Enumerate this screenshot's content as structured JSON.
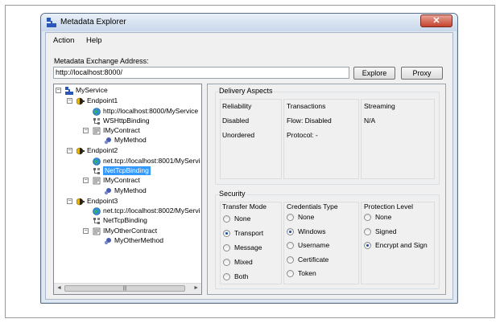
{
  "window": {
    "title": "Metadata Explorer",
    "close_glyph": "✕"
  },
  "menu": {
    "items": [
      "Action",
      "Help"
    ]
  },
  "address": {
    "label": "Metadata Exchange Address:",
    "value": "http://localhost:8000/",
    "explore_label": "Explore",
    "proxy_label": "Proxy"
  },
  "tree": {
    "nodes": [
      {
        "label": "MyService",
        "icon": "service-icon"
      },
      {
        "label": "Endpoint1",
        "icon": "endpoint-icon"
      },
      {
        "label": "http://localhost:8000/MyService",
        "icon": "address-globe-icon"
      },
      {
        "label": "WSHttpBinding",
        "icon": "binding-icon"
      },
      {
        "label": "IMyContract",
        "icon": "contract-icon"
      },
      {
        "label": "MyMethod",
        "icon": "method-icon"
      },
      {
        "label": "Endpoint2",
        "icon": "endpoint-icon"
      },
      {
        "label": "net.tcp://localhost:8001/MyServi",
        "icon": "address-globe-icon"
      },
      {
        "label": "NetTcpBinding",
        "icon": "binding-icon",
        "selected": true
      },
      {
        "label": "IMyContract",
        "icon": "contract-icon"
      },
      {
        "label": "MyMethod",
        "icon": "method-icon"
      },
      {
        "label": "Endpoint3",
        "icon": "endpoint-icon"
      },
      {
        "label": "net.tcp://localhost:8002/MyServi",
        "icon": "address-globe-icon"
      },
      {
        "label": "NetTcpBinding",
        "icon": "binding-icon"
      },
      {
        "label": "IMyOtherContract",
        "icon": "contract-icon"
      },
      {
        "label": "MyOtherMethod",
        "icon": "method-icon"
      }
    ],
    "scroll_thumb_glyph": "|||",
    "scroll_left_glyph": "◄",
    "scroll_right_glyph": "►",
    "expand_glyph": "−"
  },
  "delivery": {
    "title": "Delivery Aspects",
    "reliability": {
      "heading": "Reliability",
      "lines": [
        "Disabled",
        "Unordered"
      ]
    },
    "transactions": {
      "heading": "Transactions",
      "lines": [
        "Flow: Disabled",
        "Protocol: -"
      ]
    },
    "streaming": {
      "heading": "Streaming",
      "lines": [
        "N/A"
      ]
    }
  },
  "security": {
    "title": "Security",
    "transfer_mode": {
      "heading": "Transfer Mode",
      "options": [
        "None",
        "Transport",
        "Message",
        "Mixed",
        "Both"
      ],
      "selected": "Transport"
    },
    "credentials_type": {
      "heading": "Credentials Type",
      "options": [
        "None",
        "Windows",
        "Username",
        "Certificate",
        "Token"
      ],
      "selected": "Windows"
    },
    "protection_level": {
      "heading": "Protection Level",
      "options": [
        "None",
        "Signed",
        "Encrypt and Sign"
      ],
      "selected": "Encrypt and Sign"
    }
  },
  "colors": {
    "selection": "#3399ff",
    "close_button": "#c4432d",
    "window_frame": "#dfe8f3"
  }
}
